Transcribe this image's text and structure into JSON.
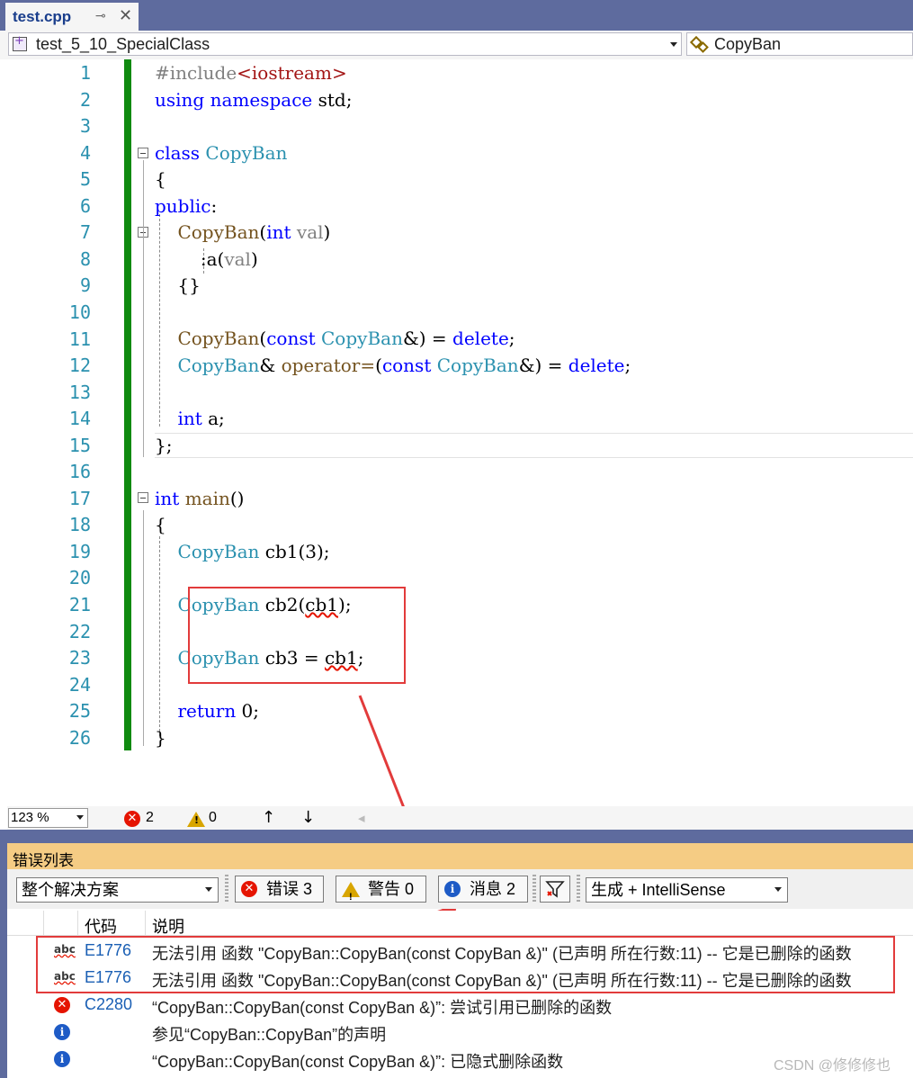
{
  "tab": {
    "title": "test.cpp",
    "pin_glyph": "⊸",
    "close_glyph": "✕"
  },
  "nav": {
    "project": "test_5_10_SpecialClass",
    "scope": "CopyBan"
  },
  "editor": {
    "line_numbers": [
      "1",
      "2",
      "3",
      "4",
      "5",
      "6",
      "7",
      "8",
      "9",
      "10",
      "11",
      "12",
      "13",
      "14",
      "15",
      "16",
      "17",
      "18",
      "19",
      "20",
      "21",
      "22",
      "23",
      "24",
      "25",
      "26"
    ]
  },
  "editor_status": {
    "zoom": "123 %",
    "errors": "2",
    "warnings": "0",
    "up_glyph": "↑",
    "down_glyph": "↓",
    "left_glyph": "◂"
  },
  "error_list": {
    "title": "错误列表",
    "scope": "整个解决方案",
    "errors_btn": "错误 3",
    "warnings_btn": "警告 0",
    "messages_btn": "消息 2",
    "build_filter": "生成 + IntelliSense",
    "col_code": "代码",
    "col_desc": "说明",
    "rows": [
      {
        "icon": "abc",
        "code": "E1776",
        "desc": "无法引用 函数 \"CopyBan::CopyBan(const CopyBan &)\" (已声明 所在行数:11) -- 它是已删除的函数"
      },
      {
        "icon": "abc",
        "code": "E1776",
        "desc": "无法引用 函数 \"CopyBan::CopyBan(const CopyBan &)\" (已声明 所在行数:11) -- 它是已删除的函数"
      },
      {
        "icon": "error-icon",
        "code": "C2280",
        "desc": "“CopyBan::CopyBan(const CopyBan &)”: 尝试引用已删除的函数"
      },
      {
        "icon": "info-icon",
        "code": "",
        "desc": "参见“CopyBan::CopyBan”的声明"
      },
      {
        "icon": "info-icon",
        "code": "",
        "desc": "“CopyBan::CopyBan(const CopyBan &)”: 已隐式删除函数"
      }
    ]
  },
  "watermark": "CSDN @修修修也",
  "colors": {
    "accent_bar": "#108a10",
    "annotation": "#e23b3b",
    "error_list_title_bg": "#f5cc84"
  }
}
